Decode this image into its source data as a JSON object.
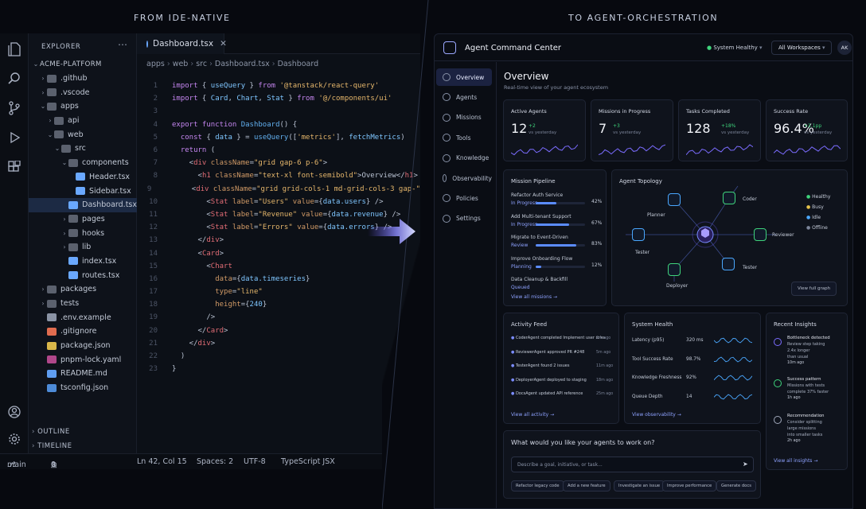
{
  "captions": {
    "left": "FROM IDE-NATIVE",
    "right": "TO AGENT-ORCHESTRATION"
  },
  "ide": {
    "explorer_title": "EXPLORER",
    "tree": [
      {
        "label": "ACME-PLATFORM",
        "depth": 0,
        "type": "root",
        "chev": "v"
      },
      {
        "label": ".github",
        "depth": 1,
        "type": "folder",
        "chev": ">"
      },
      {
        "label": ".vscode",
        "depth": 1,
        "type": "folder",
        "chev": ">"
      },
      {
        "label": "apps",
        "depth": 1,
        "type": "folder",
        "chev": "v"
      },
      {
        "label": "api",
        "depth": 2,
        "type": "folder",
        "chev": ">"
      },
      {
        "label": "web",
        "depth": 2,
        "type": "folder",
        "chev": "v"
      },
      {
        "label": "src",
        "depth": 3,
        "type": "folder",
        "chev": "v"
      },
      {
        "label": "components",
        "depth": 4,
        "type": "folder",
        "chev": "v"
      },
      {
        "label": "Header.tsx",
        "depth": 5,
        "type": "rx",
        "chev": ""
      },
      {
        "label": "Sidebar.tsx",
        "depth": 5,
        "type": "rx",
        "chev": ""
      },
      {
        "label": "Dashboard.tsx",
        "depth": 5,
        "type": "rx",
        "chev": "",
        "selected": true
      },
      {
        "label": "pages",
        "depth": 4,
        "type": "folder",
        "chev": ">"
      },
      {
        "label": "hooks",
        "depth": 4,
        "type": "folder",
        "chev": ">"
      },
      {
        "label": "lib",
        "depth": 4,
        "type": "folder",
        "chev": ">"
      },
      {
        "label": "index.tsx",
        "depth": 4,
        "type": "rx",
        "chev": ""
      },
      {
        "label": "routes.tsx",
        "depth": 4,
        "type": "rx",
        "chev": ""
      },
      {
        "label": "packages",
        "depth": 1,
        "type": "folder",
        "chev": ">"
      },
      {
        "label": "tests",
        "depth": 1,
        "type": "folder",
        "chev": ">"
      },
      {
        "label": ".env.example",
        "depth": 1,
        "type": "env",
        "chev": ""
      },
      {
        "label": ".gitignore",
        "depth": 1,
        "type": "git",
        "chev": ""
      },
      {
        "label": "package.json",
        "depth": 1,
        "type": "js",
        "chev": ""
      },
      {
        "label": "pnpm-lock.yaml",
        "depth": 1,
        "type": "yml",
        "chev": ""
      },
      {
        "label": "README.md",
        "depth": 1,
        "type": "md",
        "chev": ""
      },
      {
        "label": "tsconfig.json",
        "depth": 1,
        "type": "ts",
        "chev": ""
      }
    ],
    "outline": "OUTLINE",
    "timeline": "TIMELINE",
    "tab_label": "Dashboard.tsx",
    "breadcrumb": [
      "apps",
      "web",
      "src",
      "Dashboard.tsx",
      "Dashboard"
    ],
    "status": {
      "branch": "main",
      "errors": "0",
      "warnings": "0",
      "position": "Ln 42, Col 15",
      "spaces": "Spaces: 2",
      "encoding": "UTF-8",
      "language": "TypeScript JSX"
    }
  },
  "code_lines": [
    "[[kw|import]] { [[vr|useQuery]] } [[kw|from]] [[str|'@tanstack/react-query']]",
    "[[kw|import]] { [[vr|Card]], [[vr|Chart]], [[vr|Stat]] } [[kw|from]] [[str|'@/components/ui']]",
    "",
    "[[kw|export]] [[kw|function]] [[fn|Dashboard]]() {",
    "  [[kw|const]] { [[vr|data]] } = [[fn|useQuery]]([[[str|'metrics']]], [[vr|fetchMetrics]])",
    "  [[kw|return]] (",
    "    <[[tag|div]] [[at|className]]=[[str|\"grid gap-6 p-6\"]]>",
    "      <[[tag|h1]] [[at|className]]=[[str|\"text-xl font-semibold\"]]>Overview</[[tag|h1]]>",
    "      <[[tag|div]] [[at|className]]=[[str|\"grid grid-cols-1 md-grid-cols-3 gap-\"]]",
    "        <[[tag|Stat]] [[at|label]]=[[str|\"Users\"]] [[at|value]]={[[vr|data.users]]} />",
    "        <[[tag|Stat]] [[at|label]]=[[str|\"Revenue\"]] [[at|value]]={[[vr|data.revenue]]} />",
    "        <[[tag|Stat]] [[at|label]]=[[str|\"Errors\"]] [[at|value]]={[[vr|data.errors]]} />",
    "      </[[tag|div]]>",
    "      <[[tag|Card]]>",
    "        <[[tag|Chart]]",
    "          [[at|data]]={[[vr|data.timeseries]]}",
    "          [[at|type]]=[[str|\"line\"]]",
    "          [[at|height]]={[[vr|240]]}",
    "        />",
    "      </[[tag|Card]]>",
    "    </[[tag|div]]>",
    "  )",
    "}"
  ],
  "acc": {
    "title": "Agent Command Center",
    "health": "System Healthy",
    "workspace": "All Workspaces",
    "avatar": "AK",
    "nav": [
      "Overview",
      "Agents",
      "Missions",
      "Tools",
      "Knowledge",
      "Observability",
      "Policies",
      "Settings"
    ],
    "page_title": "Overview",
    "subtitle": "Real-time view of your agent ecosystem",
    "kpis": [
      {
        "label": "Active Agents",
        "value": "12",
        "delta": "+2",
        "note": "vs yesterday"
      },
      {
        "label": "Missions in Progress",
        "value": "7",
        "delta": "+3",
        "note": "vs yesterday"
      },
      {
        "label": "Tasks Completed",
        "value": "128",
        "delta": "+18%",
        "note": "vs yesterday"
      },
      {
        "label": "Success Rate",
        "value": "96.4%",
        "delta": "+2.1pp",
        "note": "vs yesterday"
      }
    ],
    "pipeline": {
      "title": "Mission Pipeline",
      "items": [
        {
          "name": "Refactor Auth Service",
          "state": "In Progress",
          "pct": "42%",
          "progress": 0.42
        },
        {
          "name": "Add Multi-tenant Support",
          "state": "In Progress",
          "pct": "67%",
          "progress": 0.67
        },
        {
          "name": "Migrate to Event-Driven",
          "state": "Review",
          "pct": "83%",
          "progress": 0.83
        },
        {
          "name": "Improve Onboarding Flow",
          "state": "Planning",
          "pct": "12%",
          "progress": 0.12
        },
        {
          "name": "Data Cleanup & Backfill",
          "state": "Queued",
          "pct": "",
          "progress": 0
        }
      ],
      "link": "View all missions →"
    },
    "topology": {
      "title": "Agent Topology",
      "nodes": [
        "Planner",
        "Coder",
        "Reviewer",
        "Tester",
        "Deployer",
        "Tester"
      ],
      "legend": [
        {
          "label": "Healthy",
          "color": "#3fd47c"
        },
        {
          "label": "Busy",
          "color": "#e6c34a"
        },
        {
          "label": "Idle",
          "color": "#4aa8ff"
        },
        {
          "label": "Offline",
          "color": "#7c859a"
        }
      ],
      "button": "View full graph"
    },
    "activity": {
      "title": "Activity Feed",
      "items": [
        {
          "text": "CoderAgent completed Implement user roles",
          "time": "2m ago"
        },
        {
          "text": "ReviewerAgent approved PR #248",
          "time": "5m ago"
        },
        {
          "text": "TesterAgent found 2 issues",
          "time": "11m ago"
        },
        {
          "text": "DeployerAgent deployed to staging",
          "time": "18m ago"
        },
        {
          "text": "DocsAgent updated API reference",
          "time": "25m ago"
        }
      ],
      "link": "View all activity →"
    },
    "health_card": {
      "title": "System Health",
      "items": [
        {
          "label": "Latency (p95)",
          "value": "320 ms"
        },
        {
          "label": "Tool Success Rate",
          "value": "98.7%"
        },
        {
          "label": "Knowledge Freshness",
          "value": "92%"
        },
        {
          "label": "Queue Depth",
          "value": "14"
        }
      ],
      "link": "View observability →"
    },
    "insights": {
      "title": "Recent Insights",
      "items": [
        {
          "title": "Bottleneck detected",
          "lines": [
            "Review step taking",
            "2.4x longer",
            "than usual"
          ],
          "time": "10m ago"
        },
        {
          "title": "Success pattern",
          "lines": [
            "Missions with tests",
            "complete 37% faster"
          ],
          "time": "1h ago"
        },
        {
          "title": "Recommendation",
          "lines": [
            "Consider splitting",
            "large missions",
            "into smaller tasks"
          ],
          "time": "2h ago"
        }
      ],
      "link": "View all insights →"
    },
    "prompt": {
      "title": "What would you like your agents to work on?",
      "placeholder": "Describe a goal, initiative, or task...",
      "chips": [
        "Refactor legacy code",
        "Add a new feature",
        "Investigate an issue",
        "Improve performance",
        "Generate docs"
      ]
    }
  },
  "colors": {
    "accent": "#7b8cff",
    "good": "#3fd47c",
    "panel": "#0f131c"
  }
}
